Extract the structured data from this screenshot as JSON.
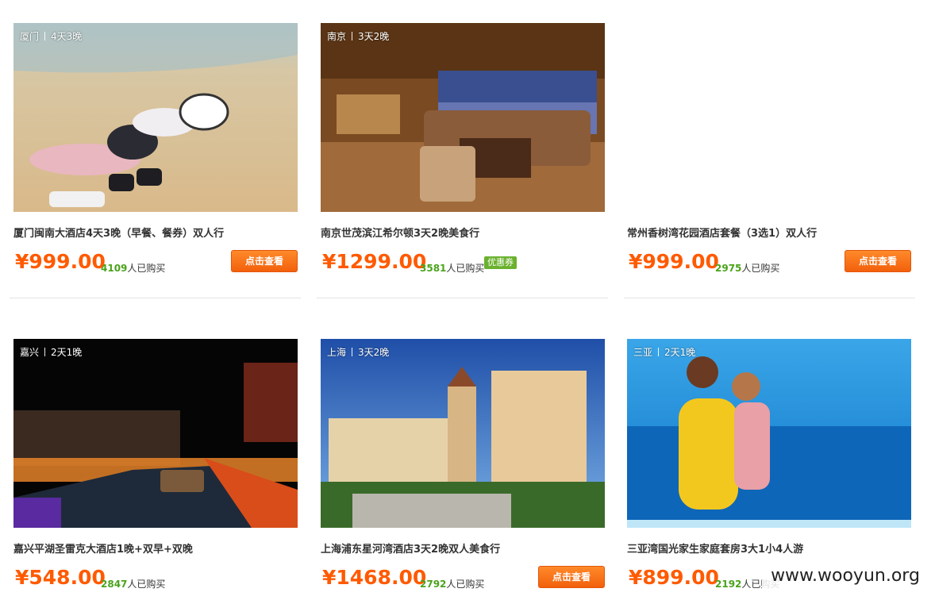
{
  "products": [
    {
      "city": "厦门",
      "duration": "4天3晚",
      "title": "厦门闽南大酒店4天3晚（早餐、餐券）双人行",
      "price": "¥999.00",
      "buyers": "4109",
      "buyers_suffix": "人已购买",
      "button": "点击查看"
    },
    {
      "city": "南京",
      "duration": "3天2晚",
      "title": "南京世茂滨江希尔顿3天2晚美食行",
      "price": "¥1299.00",
      "buyers": "3581",
      "buyers_suffix": "人已购买",
      "coupon": "优惠券"
    },
    {
      "title": "常州香树湾花园酒店套餐（3选1）双人行",
      "price": "¥999.00",
      "buyers": "2975",
      "buyers_suffix": "人已购买",
      "button": "点击查看"
    },
    {
      "city": "嘉兴",
      "duration": "2天1晚",
      "title": "嘉兴平湖圣雷克大酒店1晚+双早+双晚",
      "price": "¥548.00",
      "buyers": "2847",
      "buyers_suffix": "人已购买"
    },
    {
      "city": "上海",
      "duration": "3天2晚",
      "title": "上海浦东星河湾酒店3天2晚双人美食行",
      "price": "¥1468.00",
      "buyers": "2792",
      "buyers_suffix": "人已购买",
      "button": "点击查看"
    },
    {
      "city": "三亚",
      "duration": "2天1晚",
      "title": "三亚湾国光家生家庭套房3大1小4人游",
      "price": "¥899.00",
      "buyers": "2192",
      "buyers_suffix": "人已购买"
    }
  ],
  "watermark": "www.wooyun.org",
  "colors": {
    "price": "#ff5a00",
    "buyers_num": "#4aa31b",
    "button": "#f2600c",
    "coupon": "#6ab12e"
  }
}
